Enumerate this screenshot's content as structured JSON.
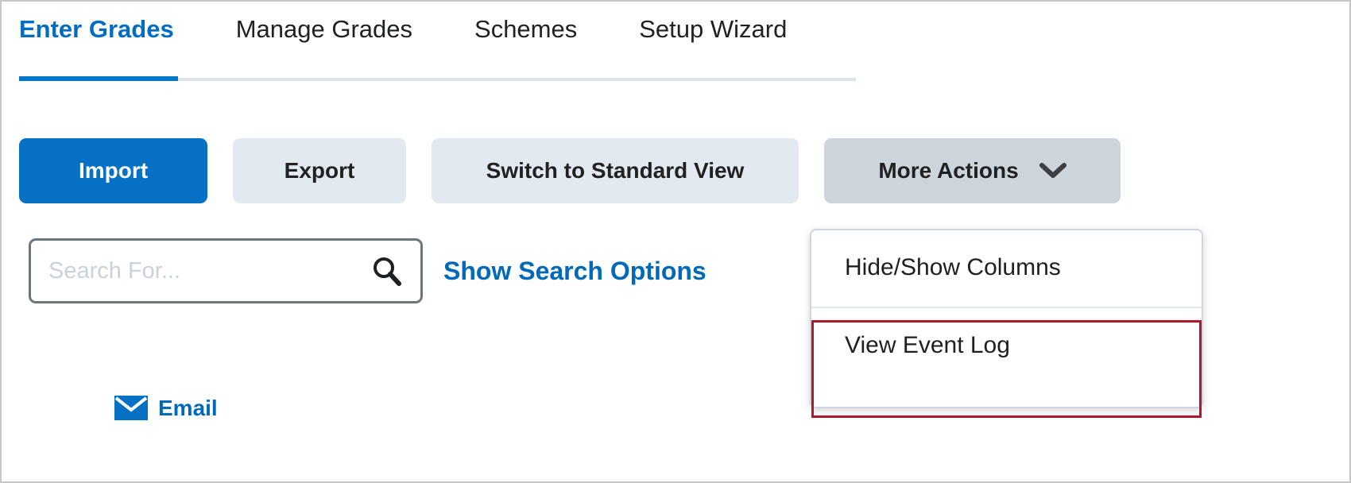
{
  "colors": {
    "accent_blue": "#0570c4",
    "link_blue": "#0069ba",
    "button_secondary": "#e3e9f0",
    "button_active": "#ccd4dc",
    "annotation_red": "#b5172a",
    "tab_underline": "#0476c8"
  },
  "tabs": [
    {
      "label": "Enter Grades",
      "active": true
    },
    {
      "label": "Manage Grades",
      "active": false
    },
    {
      "label": "Schemes",
      "active": false
    },
    {
      "label": "Setup Wizard",
      "active": false
    }
  ],
  "toolbar": {
    "import_label": "Import",
    "export_label": "Export",
    "switch_view_label": "Switch to Standard View",
    "more_actions_label": "More Actions",
    "more_actions_icon": "chevron-down-icon"
  },
  "search": {
    "value": "",
    "placeholder": "Search For...",
    "icon": "search-icon",
    "options_link_label": "Show Search Options"
  },
  "more_actions_menu": {
    "items": [
      {
        "label": "Hide/Show Columns",
        "highlighted": false
      },
      {
        "label": "View Event Log",
        "highlighted": true
      }
    ]
  },
  "email": {
    "label": "Email",
    "icon": "envelope-icon"
  }
}
